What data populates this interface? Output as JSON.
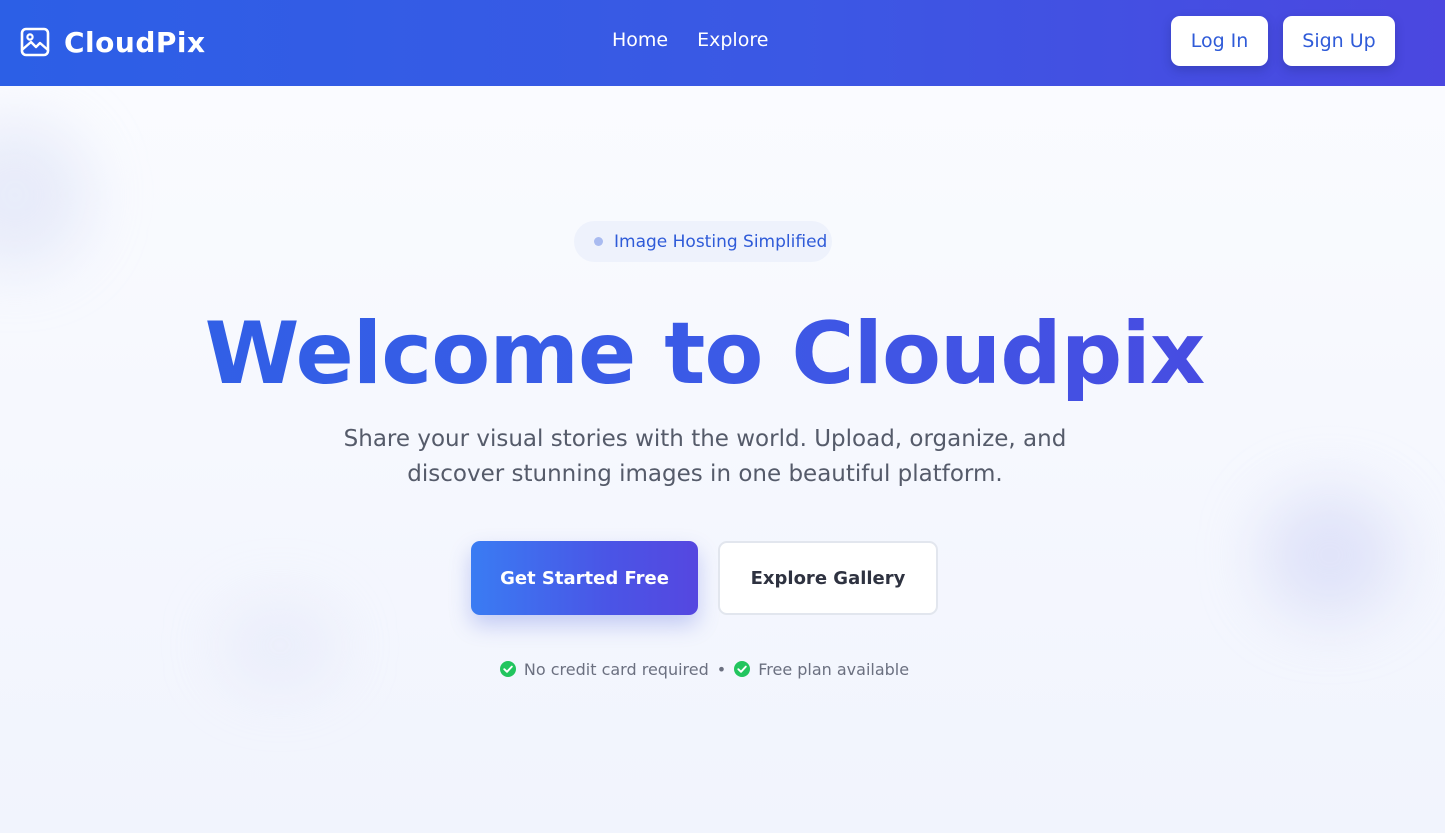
{
  "navbar": {
    "brand_name": "CloudPix",
    "brand_icon": "image-icon",
    "links": [
      {
        "label": "Home"
      },
      {
        "label": "Explore"
      }
    ],
    "login_label": "Log In",
    "signup_label": "Sign Up"
  },
  "hero": {
    "badge_text": "Image Hosting Simplified",
    "title": "Welcome to Cloudpix",
    "subtitle": "Share your visual stories with the world. Upload, organize, and discover stunning images in one beautiful platform.",
    "primary_cta": "Get Started Free",
    "secondary_cta": "Explore Gallery",
    "features": [
      {
        "text": "No credit card required",
        "icon": "check-circle-icon"
      },
      {
        "text": "Free plan available",
        "icon": "check-circle-icon"
      }
    ],
    "separator": "•"
  },
  "colors": {
    "brand_blue": "#2f5bd8",
    "accent_indigo": "#4c47e0",
    "check_green": "#22c55e"
  }
}
